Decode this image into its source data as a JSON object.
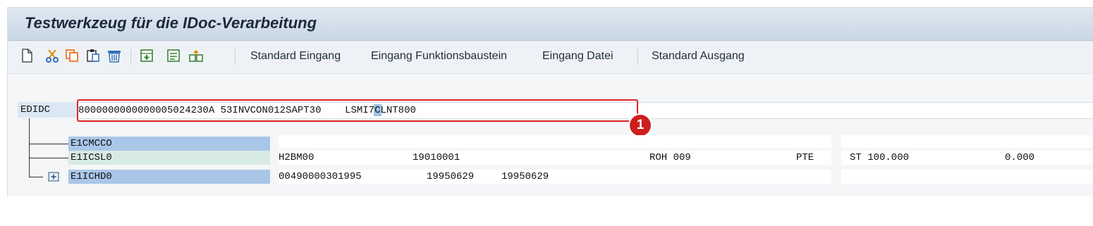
{
  "window": {
    "title": "Testwerkzeug für die IDoc-Verarbeitung"
  },
  "toolbar": {
    "icons": [
      "new-document-icon",
      "cut-icon",
      "copy-icon",
      "paste-icon",
      "delete-icon",
      "insert-segment-icon",
      "edit-segment-icon",
      "move-icon"
    ],
    "buttons": {
      "standard_inbound": "Standard Eingang",
      "inbound_function_module": "Eingang Funktionsbaustein",
      "inbound_file": "Eingang Datei",
      "standard_outbound": "Standard Ausgang"
    }
  },
  "edidc": {
    "label": "EDIDC",
    "value_before": "8000000000000005024230A 53INVCON012SAPT3",
    "value_highlight": "0",
    "value_after": "    LSMI7CLNT800"
  },
  "callout": {
    "number": "1",
    "color": "#e02424"
  },
  "segments": [
    {
      "name": "E1CMCCO",
      "cells": []
    },
    {
      "name": "E1ICSL0",
      "cells": [
        "H2BM00",
        "19010001",
        "ROH 009",
        "PTE",
        "ST 100.000",
        "0.000"
      ]
    },
    {
      "name": "E1ICHD0",
      "expand_icon": "expand-node-icon",
      "cells": [
        "00490000301995",
        "19950629",
        "19950629"
      ]
    }
  ]
}
